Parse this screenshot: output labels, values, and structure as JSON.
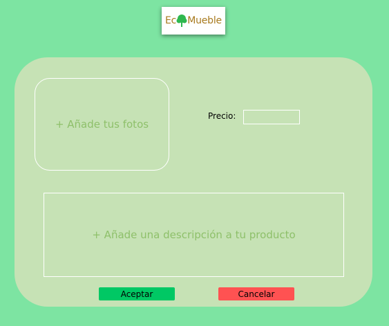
{
  "logo": {
    "text_before": "Ec",
    "text_after": "Mueble",
    "icon": "tree-icon"
  },
  "form": {
    "add_photos_label": "+ Añade tus fotos",
    "price_label": "Precio:",
    "price_value": "",
    "description_placeholder": "+ Añade una descripción a tu producto"
  },
  "buttons": {
    "accept_label": "Aceptar",
    "cancel_label": "Cancelar"
  },
  "colors": {
    "background": "#7de4a2",
    "card": "#c6e2b5",
    "placeholder_text": "#8ec06a",
    "accept": "#00c864",
    "cancel": "#ff5252",
    "logo_text": "#a87a1e",
    "logo_tree": "#2fb84f"
  }
}
